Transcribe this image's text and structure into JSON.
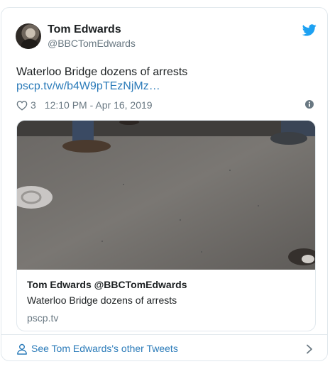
{
  "author": {
    "name": "Tom Edwards",
    "handle": "@BBCTomEdwards"
  },
  "tweet": {
    "text": "Waterloo Bridge dozens of arrests",
    "link_text": "pscp.tv/w/b4W9pTEzNjMz…",
    "likes": "3",
    "timestamp": "12:10 PM - Apr 16, 2019"
  },
  "link_card": {
    "title": "Tom Edwards @BBCTomEdwards",
    "description": "Waterloo Bridge dozens of arrests",
    "domain": "pscp.tv"
  },
  "footer": {
    "label": "See Tom Edwards's other Tweets"
  },
  "icons": {
    "brand": "twitter-bird-icon",
    "like": "heart-icon",
    "info": "info-icon",
    "profile": "person-icon",
    "more": "chevron-right-icon"
  },
  "colors": {
    "twitter_blue": "#1da1f2",
    "link": "#2b7bb9",
    "secondary_text": "#697882",
    "border": "#e1e8ed"
  }
}
